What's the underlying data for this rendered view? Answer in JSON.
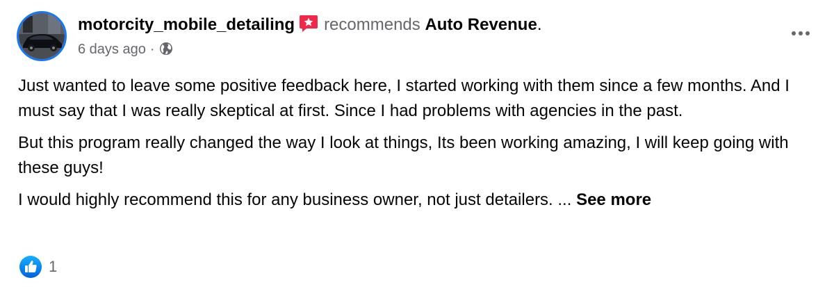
{
  "post": {
    "author": "motorcity_mobile_detailing",
    "recommends_text": "recommends",
    "page_name": "Auto Revenue",
    "period": ".",
    "timestamp": "6 days ago",
    "separator": "·",
    "audience_icon": "globe-icon",
    "badge_icon": "recommendation-star-icon",
    "more_icon": "more-options-icon",
    "paragraphs": [
      "Just wanted to leave some positive feedback here, I started working with them since a few months. And I must say that I was really skeptical at first. Since I had problems with agencies in the past.",
      "But this program really changed the way I look at things, Its been working amazing, I will keep going with these guys!",
      "I would highly recommend this for any business owner, not just detailers. ..."
    ],
    "see_more_label": "See more",
    "reactions": {
      "icon": "like-icon",
      "count": "1"
    },
    "colors": {
      "recommend_badge": "#f02849",
      "like_blue": "#1877f2",
      "secondary_text": "#65676b",
      "primary_text": "#050505"
    }
  }
}
